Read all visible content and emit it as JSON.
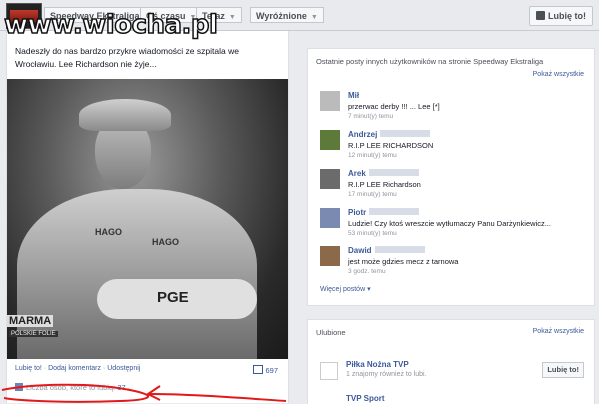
{
  "header": {
    "crumbs": [
      {
        "label": "Speedway Ekstraliga"
      },
      {
        "label": "Oś czasu"
      },
      {
        "label": "Teraz"
      },
      {
        "label": "Wyróżnione"
      }
    ],
    "like_button": "Lubię to!"
  },
  "watermark": "www.wiocha.pl",
  "post": {
    "text": "Nadeszły do nas bardzo przykre wiadomości ze szpitala we Wrocławiu. Lee Richardson nie żyje...",
    "photo_texts": {
      "pge": "PGE",
      "hagon1": "HAGO",
      "hagon2": "HAGO",
      "marma": "MARMA",
      "polskie": "POLSKIE FOLIE"
    },
    "actions": [
      "Lubię to!",
      "Dodaj komentarz",
      "Udostępnij"
    ],
    "comment_count": "697",
    "likes_label": "Liczba osób, które to lubią:",
    "likes_count": "37"
  },
  "recent": {
    "title": "Ostatnie posty innych użytkowników na stronie Speedway Ekstraliga",
    "show_all": "Pokaż wszystkie",
    "entries": [
      {
        "name": "Mił",
        "message": "przerwac derby !!! ... Lee [*]",
        "time": "7 minut(y) temu"
      },
      {
        "name": "Andrzej",
        "message": "R.I.P LEE RICHARDSON",
        "time": "12 minut(y) temu"
      },
      {
        "name": "Arek",
        "message": "R.I.P LEE Richardson",
        "time": "17 minut(y) temu"
      },
      {
        "name": "Piotr",
        "message": "Ludzie! Czy ktoś wreszcie wytłumaczy Panu Darżynkiewicz...",
        "time": "53 minut(y) temu"
      },
      {
        "name": "Dawid",
        "message": "jest może gdzies mecz z tarnowa",
        "time": "3 godz. temu"
      }
    ],
    "more_posts": "Więcej postów"
  },
  "favorites": {
    "title": "Ulubione",
    "show_all": "Pokaż wszystkie",
    "item1_name": "Piłka Nożna TVP",
    "item1_sub": "1 znajomy również to lubi.",
    "item1_like": "Lubię to!",
    "item2_name": "TVP Sport"
  },
  "colors": {
    "link": "#3b5998",
    "annotation": "#e0191b"
  }
}
